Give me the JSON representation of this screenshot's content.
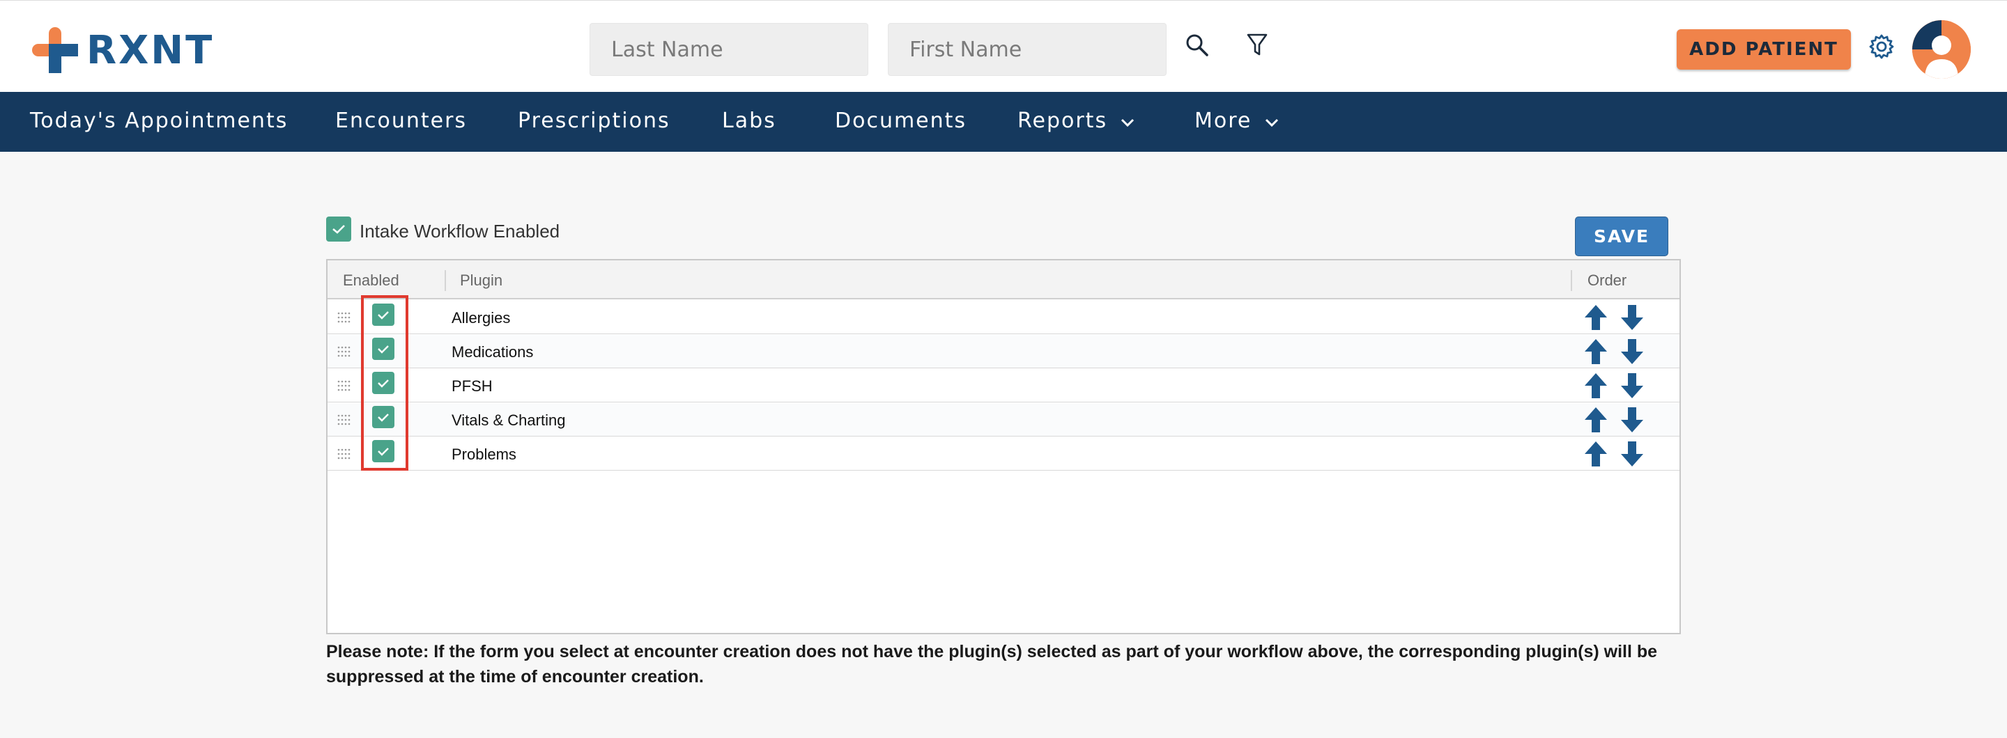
{
  "header": {
    "logo_text": "RXNT",
    "last_name_placeholder": "Last Name",
    "first_name_placeholder": "First Name",
    "add_patient_label": "ADD PATIENT",
    "search_icon": "search-icon",
    "filter_icon": "filter-icon",
    "settings_icon": "gear-icon"
  },
  "nav": {
    "items": [
      {
        "label": "Today's Appointments"
      },
      {
        "label": "Encounters"
      },
      {
        "label": "Prescriptions"
      },
      {
        "label": "Labs"
      },
      {
        "label": "Documents"
      },
      {
        "label": "Reports",
        "has_dropdown": true
      },
      {
        "label": "More",
        "has_dropdown": true
      }
    ]
  },
  "workflow": {
    "intake_label": "Intake Workflow Enabled",
    "intake_checked": true,
    "save_label": "SAVE",
    "columns": [
      "Enabled",
      "Plugin",
      "Order"
    ],
    "rows": [
      {
        "plugin": "Allergies",
        "enabled": true
      },
      {
        "plugin": "Medications",
        "enabled": true
      },
      {
        "plugin": "PFSH",
        "enabled": true
      },
      {
        "plugin": "Vitals & Charting",
        "enabled": true
      },
      {
        "plugin": "Problems",
        "enabled": true
      }
    ],
    "note": "Please note: If the form you select at encounter creation does not have the plugin(s) selected as part of your workflow above, the corresponding plugin(s) will be suppressed at the time of encounter creation."
  },
  "colors": {
    "brand_blue": "#1f5a8e",
    "brand_orange": "#f0834a",
    "nav_bg": "#15395e",
    "checkbox_green": "#4aa38a",
    "save_blue": "#3a7dbd",
    "highlight_red": "#e03a2f"
  }
}
